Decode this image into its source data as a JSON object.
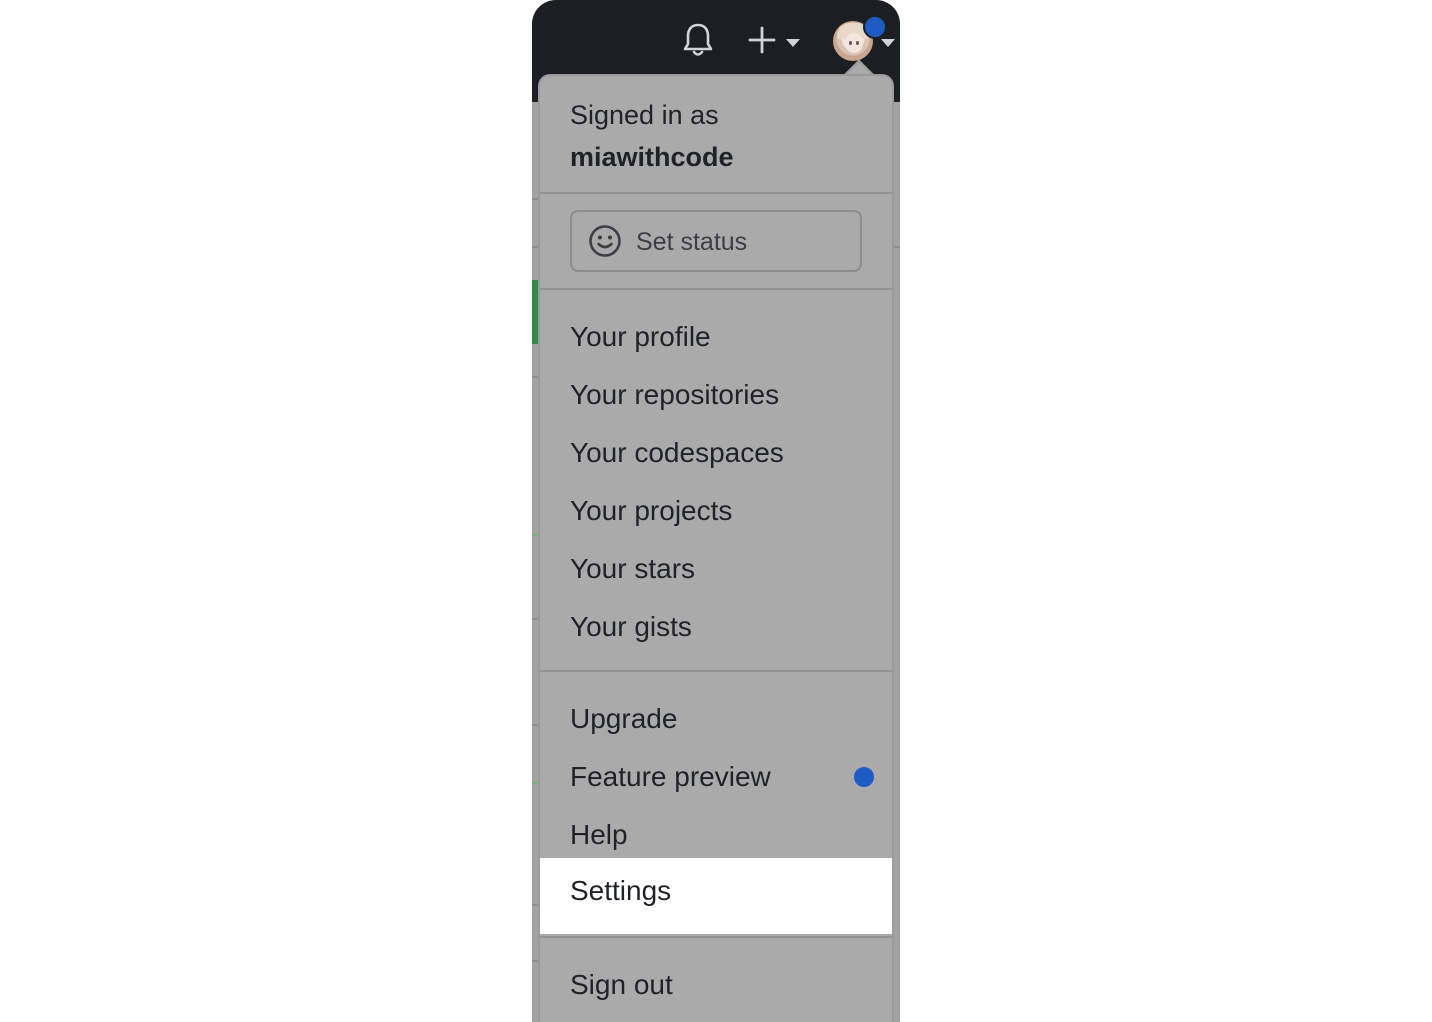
{
  "colors": {
    "header_bg": "#1b1f24",
    "menu_bg": "#aaaaaa",
    "selected_bg": "#ffffff",
    "accent_dot": "#1f5bc4",
    "text": "#1f2328"
  },
  "header": {
    "icons": [
      "bell-icon",
      "plus-icon",
      "chevron-down-icon",
      "avatar",
      "chevron-down-icon"
    ]
  },
  "menu": {
    "signed_in_label": "Signed in as",
    "username": "miawithcode",
    "set_status": "Set status",
    "group1": [
      "Your profile",
      "Your repositories",
      "Your codespaces",
      "Your projects",
      "Your stars",
      "Your gists"
    ],
    "group2": [
      "Upgrade",
      "Feature preview",
      "Help",
      "Settings"
    ],
    "selected_item": "Settings",
    "sign_out": "Sign out"
  }
}
